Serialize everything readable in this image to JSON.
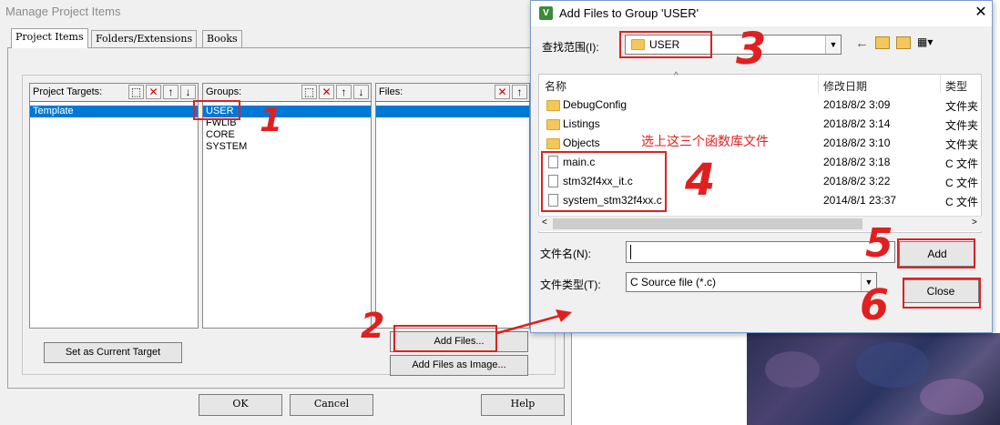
{
  "manage_dialog": {
    "title": "Manage Project Items",
    "tabs": [
      "Project Items",
      "Folders/Extensions",
      "Books"
    ],
    "targets": {
      "header": "Project Targets:",
      "items": [
        "Template"
      ]
    },
    "groups": {
      "header": "Groups:",
      "items": [
        "USER",
        "FWLIB",
        "CORE",
        "SYSTEM"
      ]
    },
    "files": {
      "header": "Files:"
    },
    "set_current_target": "Set as Current Target",
    "add_files": "Add Files...",
    "add_files_image": "Add Files as Image...",
    "ok": "OK",
    "cancel": "Cancel",
    "help": "Help"
  },
  "add_dialog": {
    "title": "Add Files to Group 'USER'",
    "look_in_label": "查找范围(I):",
    "look_in_value": "USER",
    "columns": {
      "name": "名称",
      "modified": "修改日期",
      "type": "类型"
    },
    "rows": [
      {
        "icon": "folder-icon",
        "name": "DebugConfig",
        "date": "2018/8/2 3:09",
        "type": "文件夹"
      },
      {
        "icon": "folder-icon",
        "name": "Listings",
        "date": "2018/8/2 3:14",
        "type": "文件夹"
      },
      {
        "icon": "folder-icon",
        "name": "Objects",
        "date": "2018/8/2 3:10",
        "type": "文件夹"
      },
      {
        "icon": "file-icon",
        "name": "main.c",
        "date": "2018/8/2 3:18",
        "type": "C 文件"
      },
      {
        "icon": "file-icon",
        "name": "stm32f4xx_it.c",
        "date": "2018/8/2 3:22",
        "type": "C 文件"
      },
      {
        "icon": "file-icon",
        "name": "system_stm32f4xx.c",
        "date": "2014/8/1 23:37",
        "type": "C 文件"
      }
    ],
    "filename_label": "文件名(N):",
    "filename_value": "",
    "filetype_label": "文件类型(T):",
    "filetype_value": "C Source file (*.c)",
    "add": "Add",
    "close": "Close"
  },
  "annotations": {
    "note": "选上这三个函数库文件",
    "step1": "1",
    "step2": "2",
    "step3": "3",
    "step4": "4",
    "step5": "5",
    "step6": "6",
    "color": "#e02020"
  },
  "colors": {
    "selection": "#0078d7",
    "folder": "#f3c75b"
  }
}
